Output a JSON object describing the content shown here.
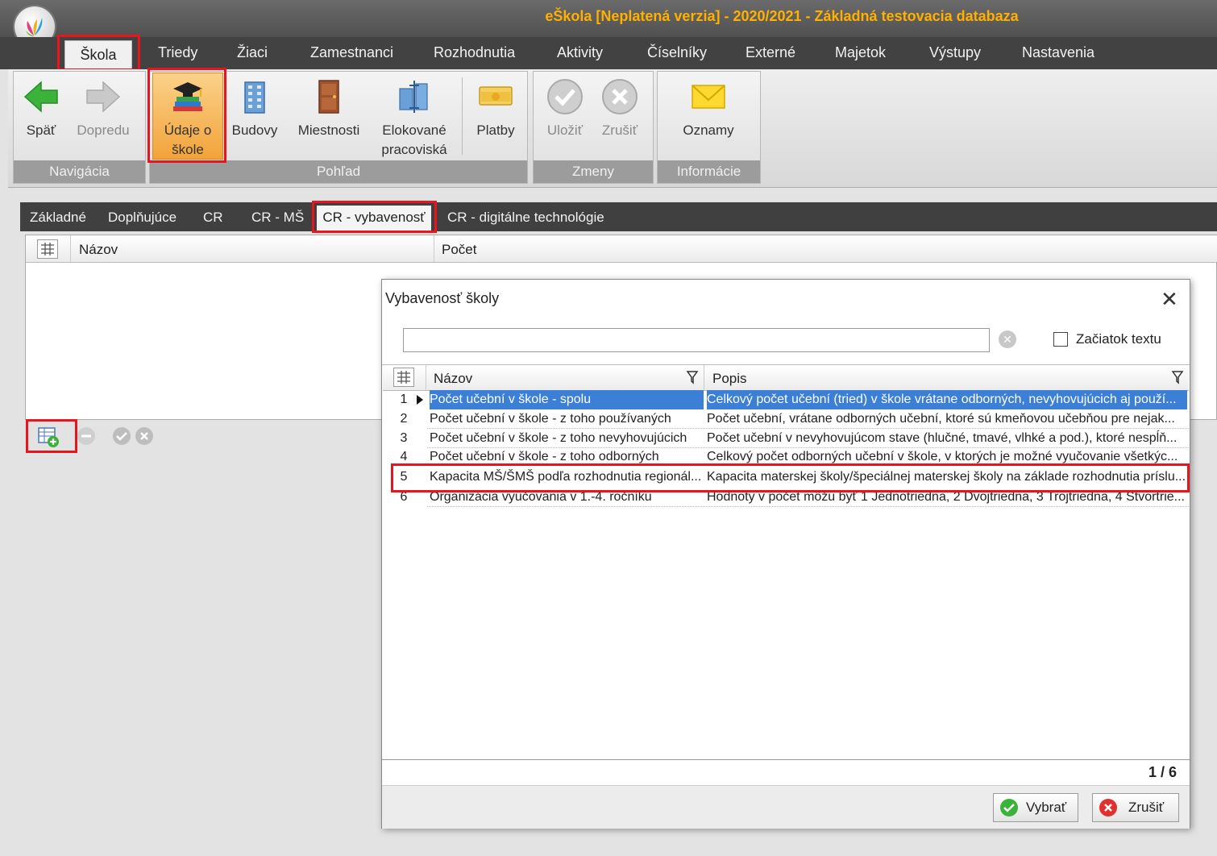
{
  "window": {
    "title": "eŠkola [Neplatená verzia] - 2020/2021 - Základná testovacia databaza"
  },
  "menu": [
    "Škola",
    "Triedy",
    "Žiaci",
    "Zamestnanci",
    "Rozhodnutia",
    "Aktivity",
    "Číselníky",
    "Externé",
    "Majetok",
    "Výstupy",
    "Nastavenia"
  ],
  "ribbon": {
    "navigacia": {
      "label": "Navigácia",
      "back": "Späť",
      "forward": "Dopredu"
    },
    "pohlad": {
      "label": "Pohľad",
      "udaje_line1": "Údaje o",
      "udaje_line2": "škole",
      "budovy": "Budovy",
      "miestnosti": "Miestnosti",
      "elokovane_line1": "Elokované",
      "elokovane_line2": "pracoviská",
      "platby": "Platby"
    },
    "zmeny": {
      "label": "Zmeny",
      "save": "Uložiť",
      "cancel": "Zrušiť"
    },
    "informacie": {
      "label": "Informácie",
      "oznamy": "Oznamy"
    }
  },
  "tabs": [
    "Základné",
    "Doplňujúce",
    "CR",
    "CR - MŠ",
    "CR - vybavenosť",
    "CR - digitálne technológie"
  ],
  "grid": {
    "col_name": "Názov",
    "col_count": "Počet"
  },
  "dialog": {
    "title": "Vybavenosť školy",
    "close": "✕",
    "search_value": "",
    "checkbox_label": "Začiatok textu",
    "col_name": "Názov",
    "col_desc": "Popis",
    "rows": [
      {
        "num": "1",
        "name": "Počet učební v škole - spolu",
        "desc": "Celkový počet učební (tried) v škole vrátane odborných, nevyhovujúcich aj použí..."
      },
      {
        "num": "2",
        "name": "Počet učební v škole - z toho používaných",
        "desc": "Počet učební, vrátane odborných učební, ktoré sú kmeňovou učebňou pre nejak..."
      },
      {
        "num": "3",
        "name": "Počet učební v škole - z toho nevyhovujúcich",
        "desc": "Počet učební v nevyhovujúcom stave (hlučné, tmavé, vlhké a pod.), ktoré nespĺň..."
      },
      {
        "num": "4",
        "name": "Počet učební v škole - z toho odborných",
        "desc": "Celkový počet odborných učební v škole, v ktorých je možné vyučovanie všetkýc..."
      },
      {
        "num": "5",
        "name": "Kapacita MŠ/ŠMŠ podľa rozhodnutia regionál...",
        "desc": "Kapacita materskej školy/špeciálnej materskej školy na základe rozhodnutia príslu..."
      },
      {
        "num": "6",
        "name": "Organizácia vyučovania v 1.-4. ročníku",
        "desc": "Hodnoty v počet môžu byť 1 Jednotriedna, 2 Dvojtriedna, 3 Trojtriedna, 4 Štvortrie..."
      }
    ],
    "counter": "1 / 6",
    "btn_select": "Vybrať",
    "btn_cancel": "Zrušiť"
  },
  "colors": {
    "accent_red": "#e8151f",
    "selection": "#3b7fd6",
    "title_text": "#ffb000"
  }
}
